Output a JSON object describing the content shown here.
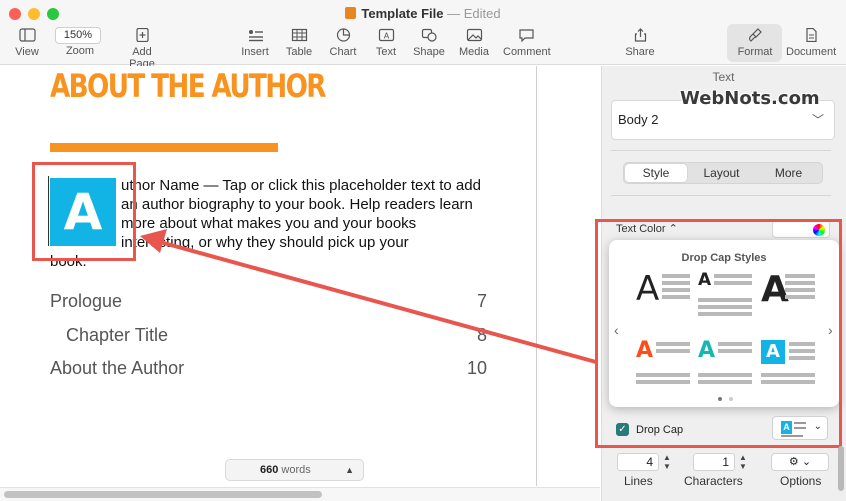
{
  "window": {
    "title": "Template File",
    "status": "— Edited"
  },
  "toolbar": {
    "view": "View",
    "zoom_value": "150%",
    "zoom": "Zoom",
    "add_page": "Add Page",
    "insert": "Insert",
    "table": "Table",
    "chart": "Chart",
    "text": "Text",
    "shape": "Shape",
    "media": "Media",
    "comment": "Comment",
    "share": "Share",
    "format": "Format",
    "document": "Document"
  },
  "document": {
    "heading": "ABOUT THE AUTHOR",
    "dropcap_letter": "A",
    "paragraph": "uthor Name — Tap or click this placeholder text to add an author biography to your book. Help readers learn more about what makes you and your books interesting, or why they should pick up your",
    "paragraph_end": "book.",
    "toc": [
      {
        "label": "Prologue",
        "page": "7"
      },
      {
        "label": "Chapter Title",
        "page": "8"
      },
      {
        "label": "About the Author",
        "page": "10"
      }
    ],
    "word_count": "660",
    "word_count_unit": "words"
  },
  "sidebar": {
    "title": "Text",
    "watermark": "WebNots.com",
    "paragraph_style": "Body 2",
    "tabs": [
      "Style",
      "Layout",
      "More"
    ],
    "text_color_label": "Text Color",
    "popover_title": "Drop Cap Styles",
    "drop_cap_styles": [
      {
        "letter": "A",
        "color": "#111111"
      },
      {
        "letter": "A",
        "color": "#111111"
      },
      {
        "letter": "A",
        "color": "#111111"
      },
      {
        "letter": "A",
        "color": "#ff4d1a"
      },
      {
        "letter": "A",
        "color": "#14b8b0"
      },
      {
        "letter": "A",
        "color": "#12b4e6"
      }
    ],
    "drop_cap_label": "Drop Cap",
    "drop_cap_checked": true,
    "lines_value": "4",
    "lines_label": "Lines",
    "characters_value": "1",
    "characters_label": "Characters",
    "options_label": "Options"
  },
  "colors": {
    "accent_orange": "#f7931e",
    "dropcap_blue": "#12b4e6",
    "highlight_red": "#e8564e"
  }
}
